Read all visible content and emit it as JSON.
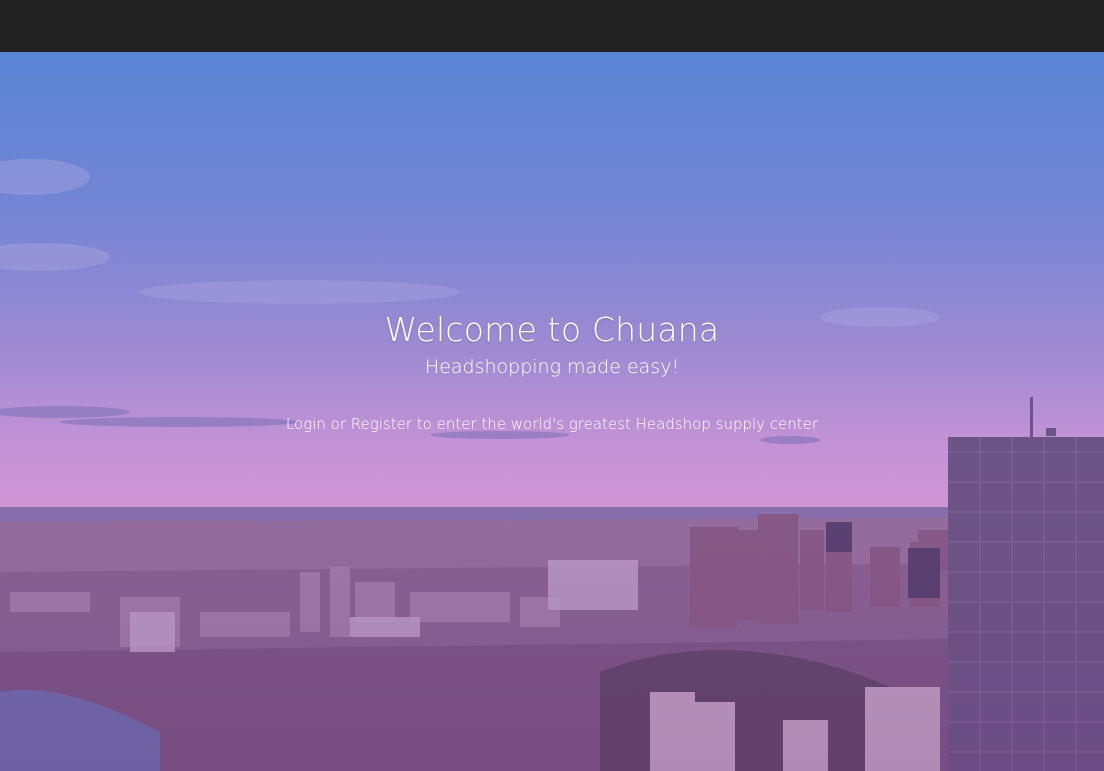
{
  "hero": {
    "title": "Welcome to Chuana",
    "subtitle": "Headshopping made easy!",
    "message_login": "Login",
    "message_or": " or ",
    "message_register": "Register",
    "message_rest": " to enter the world's greatest Headshop supply center"
  },
  "colors": {
    "topbar": "#222222",
    "sky_top": "#5b86d3",
    "sky_horizon": "#d3a2d6",
    "city": "#7a5f86",
    "text": "#ffffff"
  }
}
